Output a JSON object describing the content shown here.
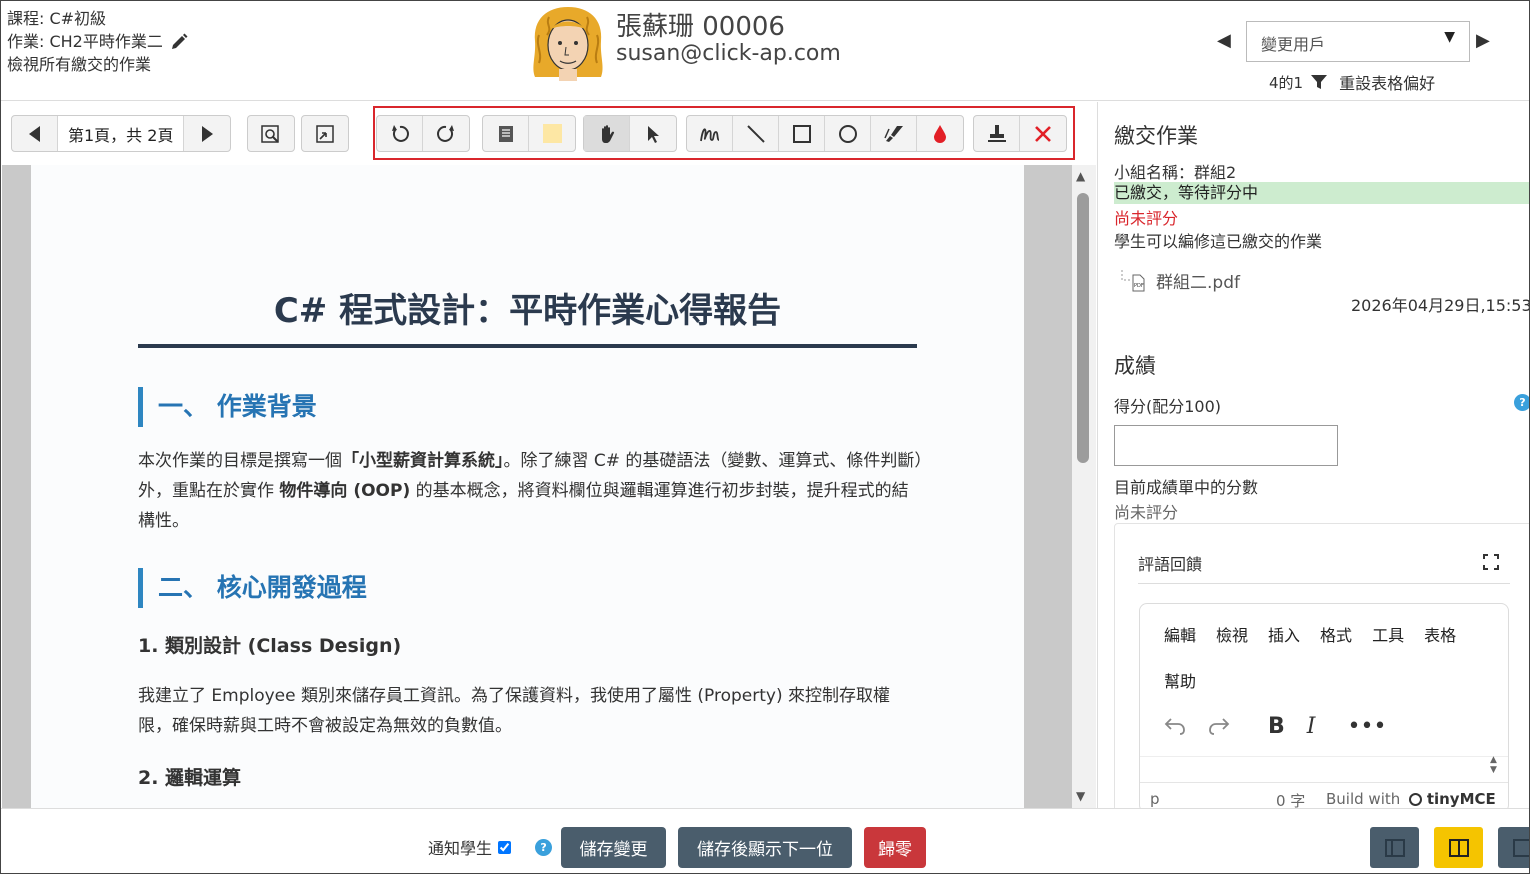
{
  "header": {
    "course": "課程: C#初級",
    "assignment": "作業: CH2平時作業二",
    "view_all": "檢視所有繳交的作業",
    "user_name": "張蘇珊 00006",
    "user_email": "susan@click-ap.com",
    "change_user": "變更用戶",
    "filter_count": "4的1",
    "reset_table_prefs": "重設表格偏好"
  },
  "toolbar": {
    "page_label": "第1頁，共 2頁",
    "icons": [
      "prev-page-icon",
      "next-page-icon",
      "search-icon",
      "expand-icon",
      "undo-icon",
      "redo-icon",
      "comment-icon",
      "highlight-color-icon",
      "pan-icon",
      "select-icon",
      "pen-icon",
      "line-icon",
      "rectangle-icon",
      "circle-icon",
      "highlighter-icon",
      "color-drop-icon",
      "stamp-icon",
      "delete-icon"
    ]
  },
  "document": {
    "title": "C# 程式設計：平時作業心得報告",
    "section1": "一、 作業背景",
    "para1_a": "本次作業的目標是撰寫一個",
    "para1_b": "「小型薪資計算系統」",
    "para1_c": "。除了練習  C#  的基礎語法（變數、運算式、條件判斷）外，重點在於實作 ",
    "para1_d": "物件導向 (OOP)",
    "para1_e": " 的基本概念，將資料欄位與邏輯運算進行初步封裝，提升程式的結構性。",
    "section2": "二、 核心開發過程",
    "sub1": "1. 類別設計 (Class Design)",
    "para2": "我建立了 Employee 類別來儲存員工資訊。為了保護資料，我使用了屬性 (Property) 來控制存取權限，確保時薪與工時不會被設定為無效的負數值。",
    "sub2": "2. 邏輯運算"
  },
  "submission": {
    "heading": "繳交作業",
    "group": "小組名稱：群組2",
    "status": "已繳交，等待評分中",
    "not_graded": "尚未評分",
    "editable": "學生可以編修這已繳交的作業",
    "file": "群組二.pdf",
    "date": "2026年04月29日,15:53"
  },
  "grade": {
    "heading": "成績",
    "label": "得分(配分100)",
    "value": "",
    "current_label": "目前成績單中的分數",
    "current_value": "尚未評分",
    "help": "?"
  },
  "feedback": {
    "title": "評語回饋",
    "menu": [
      "編輯",
      "檢視",
      "插入",
      "格式",
      "工具",
      "表格"
    ],
    "menu_help": "幫助",
    "status_p": "p",
    "word_count": "0 字",
    "build_with": "Build with",
    "tinymce": "tinyMCE"
  },
  "footer": {
    "notify_label": "通知學生",
    "notify_checked": true,
    "save": "儲存變更",
    "save_next": "儲存後顯示下一位",
    "reset": "歸零",
    "help": "?"
  },
  "colors": {
    "accent_red": "#d9262c",
    "button_dark": "#4a5d6c",
    "button_red": "#c9373b",
    "status_green": "#cdeccf",
    "layout_active": "#f5c400",
    "section_blue": "#2674b3"
  }
}
